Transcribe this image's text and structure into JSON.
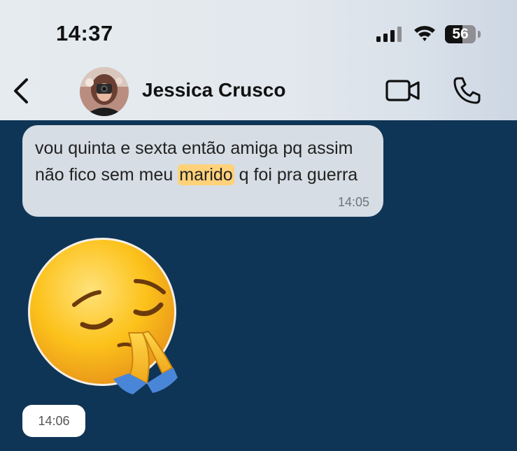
{
  "status_bar": {
    "time": "14:37",
    "battery": "56",
    "battery_level": 0.56
  },
  "header": {
    "contact_name": "Jessica Crusco"
  },
  "messages": [
    {
      "text_before": "vou quinta e sexta então amiga pq assim não fico sem meu ",
      "highlight": "marido",
      "text_after": " q foi pra guerra",
      "time": "14:05"
    },
    {
      "sticker": "pensive-praying-emoji",
      "time": "14:06"
    }
  ],
  "icons": {
    "back": "chevron-left-icon",
    "video": "video-camera-icon",
    "call": "phone-icon"
  },
  "colors": {
    "chat_background": "#0f3556",
    "incoming_bubble": "#d6dde4",
    "highlight": "#ffd27a"
  }
}
